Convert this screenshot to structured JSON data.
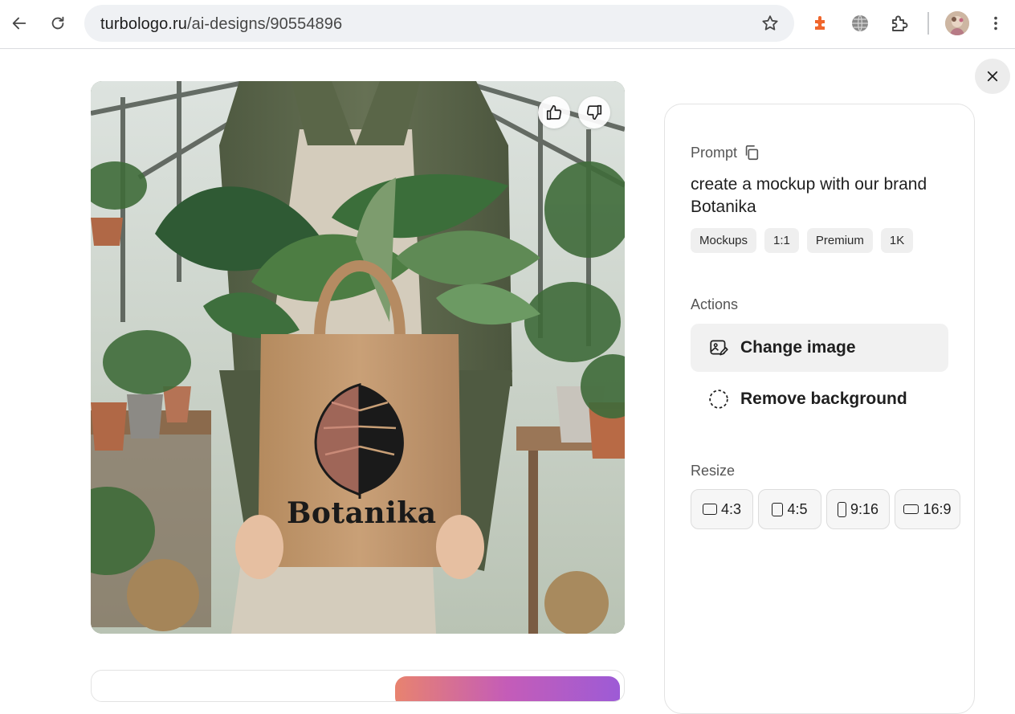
{
  "browser": {
    "url_host": "turbologo.ru",
    "url_path": "/ai-designs/90554896"
  },
  "panel": {
    "prompt_label": "Prompt",
    "prompt_text": "create a mockup with our brand Botanika",
    "tags": [
      "Mockups",
      "1:1",
      "Premium",
      "1K"
    ],
    "actions_label": "Actions",
    "actions": {
      "change_image": "Change image",
      "remove_background": "Remove background"
    },
    "resize_label": "Resize",
    "resize_options": [
      "4:3",
      "4:5",
      "9:16",
      "16:9"
    ]
  },
  "image": {
    "bag_brand": "Botanika"
  },
  "colors": {
    "accent_gradient": [
      "#e8836f",
      "#c45cb8",
      "#9d5bd6"
    ],
    "chip_bg": "#efefef",
    "highlight_action_bg": "#f1f1f1"
  }
}
